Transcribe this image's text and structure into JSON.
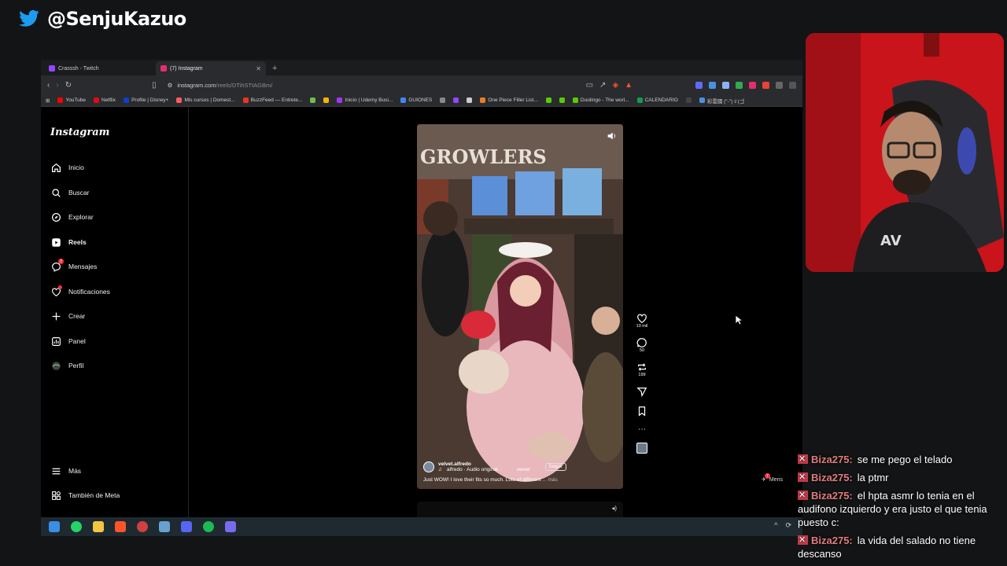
{
  "overlay": {
    "handle": "@SenjuKazuo"
  },
  "browser": {
    "tabs": [
      {
        "label": "Crasssh - Twitch",
        "color": "#9146ff"
      },
      {
        "label": "(7) Instagram",
        "color": "#e1306c"
      }
    ],
    "url_host": "instagram.com",
    "url_path": "/reels/DTihSTtAGBm/",
    "bookmarks": [
      {
        "label": "YouTube",
        "color": "#ff0000"
      },
      {
        "label": "Netflix",
        "color": "#e50914"
      },
      {
        "label": "Profile | Disney+",
        "color": "#113ccf"
      },
      {
        "label": "Mis cursos | Domest...",
        "color": "#ff5a5f"
      },
      {
        "label": "BuzzFeed — Entrete...",
        "color": "#ee3322"
      },
      {
        "label": "",
        "color": "#6cbf4a"
      },
      {
        "label": "",
        "color": "#f4b400"
      },
      {
        "label": "Inicio | Udemy Busi...",
        "color": "#a435f0"
      },
      {
        "label": "GUIONES",
        "color": "#4285f4"
      },
      {
        "label": "",
        "color": "#888888"
      },
      {
        "label": "",
        "color": "#9146ff"
      },
      {
        "label": "",
        "color": "#cccccc"
      },
      {
        "label": "One Piece Filler List...",
        "color": "#e67e22"
      },
      {
        "label": "",
        "color": "#58cc02"
      },
      {
        "label": "",
        "color": "#58cc02"
      },
      {
        "label": "Duolingo - The worl...",
        "color": "#58cc02"
      },
      {
        "label": "CALENDARIO",
        "color": "#0f9d58"
      },
      {
        "label": "",
        "color": "#444444"
      },
      {
        "label": "彩雲國 (\"-\")ゞ(ゴ",
        "color": "#4a90e2"
      }
    ]
  },
  "instagram": {
    "logo": "Instagram",
    "nav": [
      {
        "label": "Inicio",
        "icon": "home-icon"
      },
      {
        "label": "Buscar",
        "icon": "search-icon"
      },
      {
        "label": "Explorar",
        "icon": "compass-icon"
      },
      {
        "label": "Reels",
        "icon": "reels-icon"
      },
      {
        "label": "Mensajes",
        "icon": "messenger-icon",
        "badge": "7"
      },
      {
        "label": "Notificaciones",
        "icon": "heart-icon"
      },
      {
        "label": "Crear",
        "icon": "plus-icon"
      },
      {
        "label": "Panel",
        "icon": "dashboard-icon"
      },
      {
        "label": "Perfil",
        "icon": "profile-icon"
      }
    ],
    "more": "Más",
    "meta": "También de Meta",
    "reel": {
      "sign_text": "GROWLERS",
      "username": "velvet.alfredo",
      "audio": "alfredo · Audio original",
      "audio_tag": "velvet",
      "follow": "Seguir",
      "caption": "Just WOW! I love their fits so much. Lots of different",
      "caption_more": "... más",
      "likes": "10 mil",
      "comments": "50",
      "reposts": "199"
    },
    "messages_pill": {
      "badge": "7",
      "label": "Mens"
    }
  },
  "chat": [
    {
      "user": "Biza275:",
      "text": "se me pego el telado"
    },
    {
      "user": "Biza275:",
      "text": "la ptmr"
    },
    {
      "user": "Biza275:",
      "text": "el hpta asmr lo tenia en el audifono izquierdo y era justo el que tenia puesto c:"
    },
    {
      "user": "Biza275:",
      "text": "la vida del salado no tiene descanso"
    }
  ],
  "colors": {
    "accent_red": "#ff3040",
    "chat_name": "#e07b7b",
    "webcam_bg": "#c8141a"
  }
}
